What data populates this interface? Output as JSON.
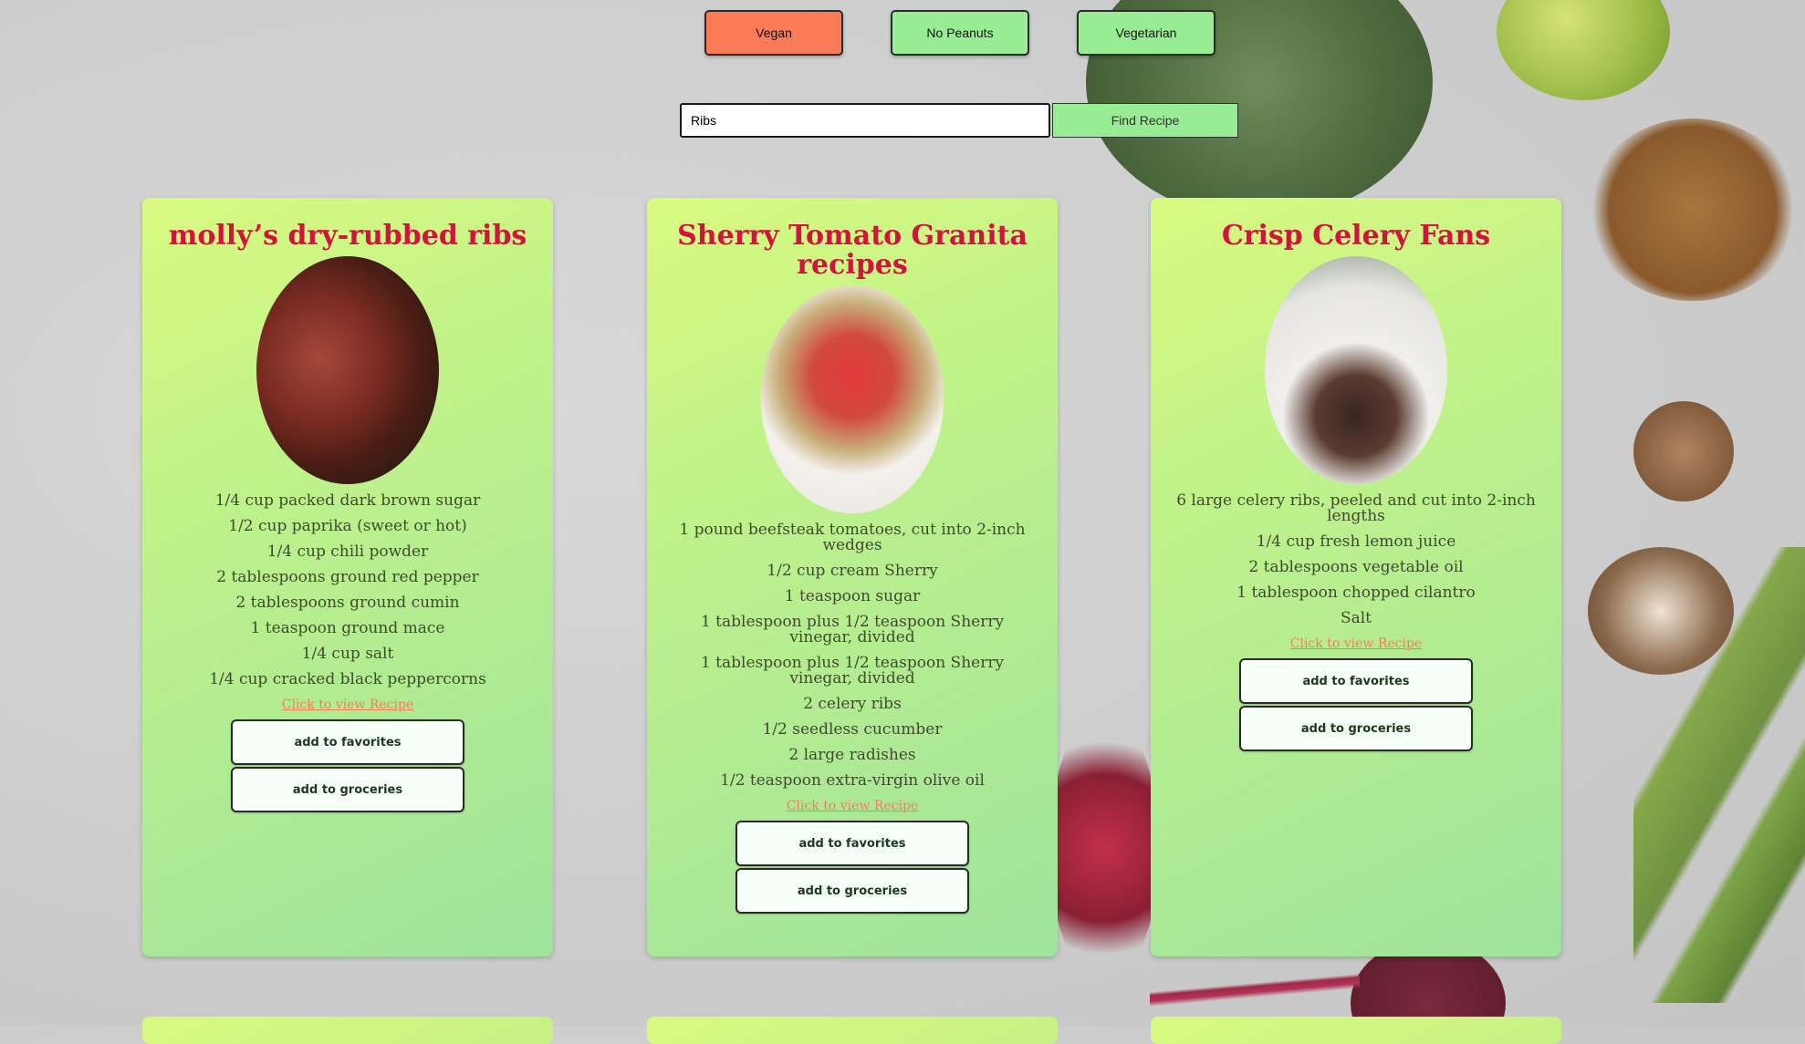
{
  "filters": [
    {
      "label": "Vegan",
      "active": true
    },
    {
      "label": "No Peanuts",
      "active": false
    },
    {
      "label": "Vegetarian",
      "active": false
    }
  ],
  "search": {
    "value": "Ribs",
    "button_label": "Find Recipe"
  },
  "colors": {
    "title": "#d0143e",
    "link": "#f77d5a",
    "active_filter": "#f97c57",
    "inactive_filter": "#98ec93"
  },
  "recipes": [
    {
      "title": "molly’s dry-rubbed ribs",
      "ingredients": [
        "1/4 cup packed dark brown sugar",
        "1/2 cup paprika (sweet or hot)",
        "1/4 cup chili powder",
        "2 tablespoons ground red pepper",
        "2 tablespoons ground cumin",
        "1 teaspoon ground mace",
        "1/4 cup salt",
        "1/4 cup cracked black peppercorns"
      ],
      "link_label": "Click to view Recipe",
      "favorites_label": "add to favorites",
      "groceries_label": "add to groceries"
    },
    {
      "title": "Sherry Tomato Granita recipes",
      "ingredients": [
        "1 pound beefsteak tomatoes, cut into 2-inch wedges",
        "1/2 cup cream Sherry",
        "1 teaspoon sugar",
        "1 tablespoon plus 1/2 teaspoon Sherry vinegar, divided",
        "1 tablespoon plus 1/2 teaspoon Sherry vinegar, divided",
        "2 celery ribs",
        "1/2 seedless cucumber",
        "2 large radishes",
        "1/2 teaspoon extra-virgin olive oil"
      ],
      "link_label": "Click to view Recipe",
      "favorites_label": "add to favorites",
      "groceries_label": "add to groceries"
    },
    {
      "title": "Crisp Celery Fans",
      "ingredients": [
        "6 large celery ribs, peeled and cut into 2-inch lengths",
        "1/4 cup fresh lemon juice",
        "2 tablespoons vegetable oil",
        "1 tablespoon chopped cilantro",
        "Salt"
      ],
      "link_label": "Click to view Recipe",
      "favorites_label": "add to favorites",
      "groceries_label": "add to groceries"
    }
  ]
}
